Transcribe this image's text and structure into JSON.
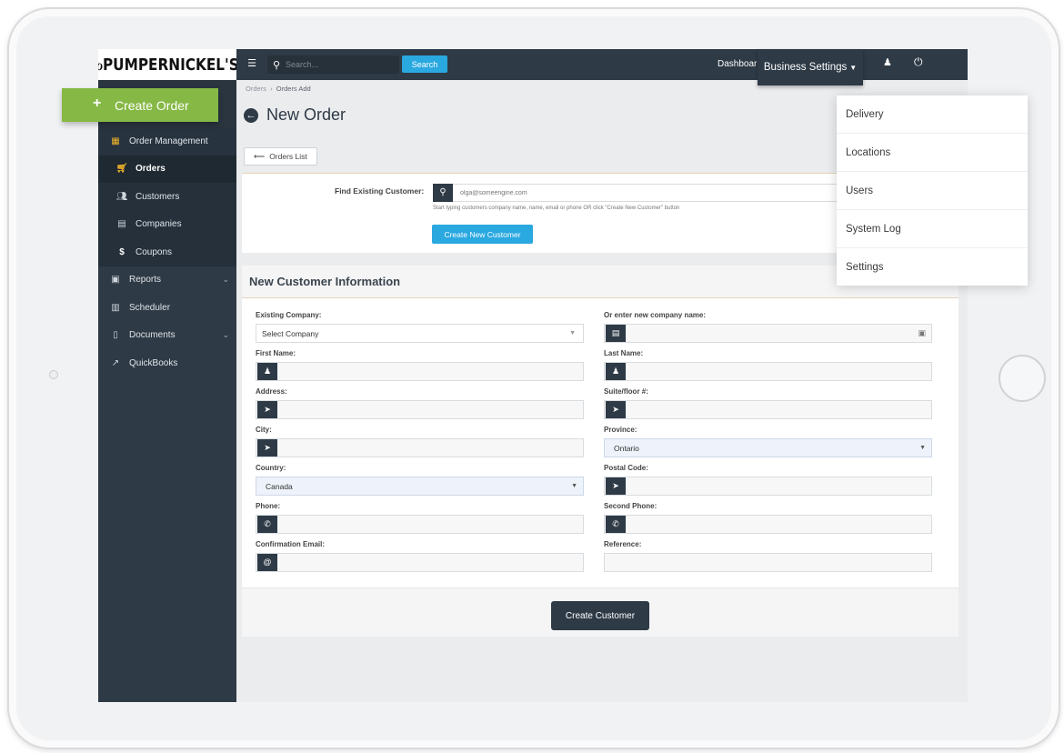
{
  "brand": {
    "logo": "ℴPUMPERNICKEL'S"
  },
  "topbar": {
    "search_placeholder": "Search...",
    "search_button": "Search",
    "dashboard": "Dashboar",
    "business_settings": "Business Settings"
  },
  "business_menu": {
    "items": [
      "Delivery",
      "Locations",
      "Users",
      "System Log",
      "Settings"
    ]
  },
  "create_order": "Create Order",
  "sidebar": {
    "items": [
      {
        "label": "Order Management",
        "icon": "grid-icon"
      },
      {
        "label": "Orders",
        "icon": "cart-icon"
      },
      {
        "label": "Customers",
        "icon": "users-icon"
      },
      {
        "label": "Companies",
        "icon": "building-icon"
      },
      {
        "label": "Coupons",
        "icon": "dollar-icon"
      },
      {
        "label": "Reports",
        "icon": "chart-icon"
      },
      {
        "label": "Scheduler",
        "icon": "calendar-icon"
      },
      {
        "label": "Documents",
        "icon": "document-icon"
      },
      {
        "label": "QuickBooks",
        "icon": "external-link-icon"
      }
    ]
  },
  "breadcrumb": {
    "root": "Orders",
    "sep": "›",
    "current": "Orders Add"
  },
  "page_title": "New Order",
  "orders_list_button": "Orders List",
  "find_customer": {
    "label": "Find Existing Customer:",
    "placeholder": "olga@someengine.com",
    "help": "Start typing customers company name, name, email or phone OR click \"Create New Customer\" button",
    "button": "Create New Customer"
  },
  "new_customer": {
    "heading": "New Customer Information",
    "existing_company_label": "Existing Company:",
    "existing_company_value": "Select Company",
    "new_company_label": "Or enter new company name:",
    "first_name_label": "First Name:",
    "last_name_label": "Last Name:",
    "address_label": "Address:",
    "suite_label": "Suite/floor #:",
    "city_label": "City:",
    "province_label": "Province:",
    "province_value": "Ontario",
    "country_label": "Country:",
    "country_value": "Canada",
    "postal_label": "Postal Code:",
    "phone_label": "Phone:",
    "second_phone_label": "Second Phone:",
    "email_label": "Confirmation Email:",
    "reference_label": "Reference:",
    "submit": "Create Customer"
  }
}
